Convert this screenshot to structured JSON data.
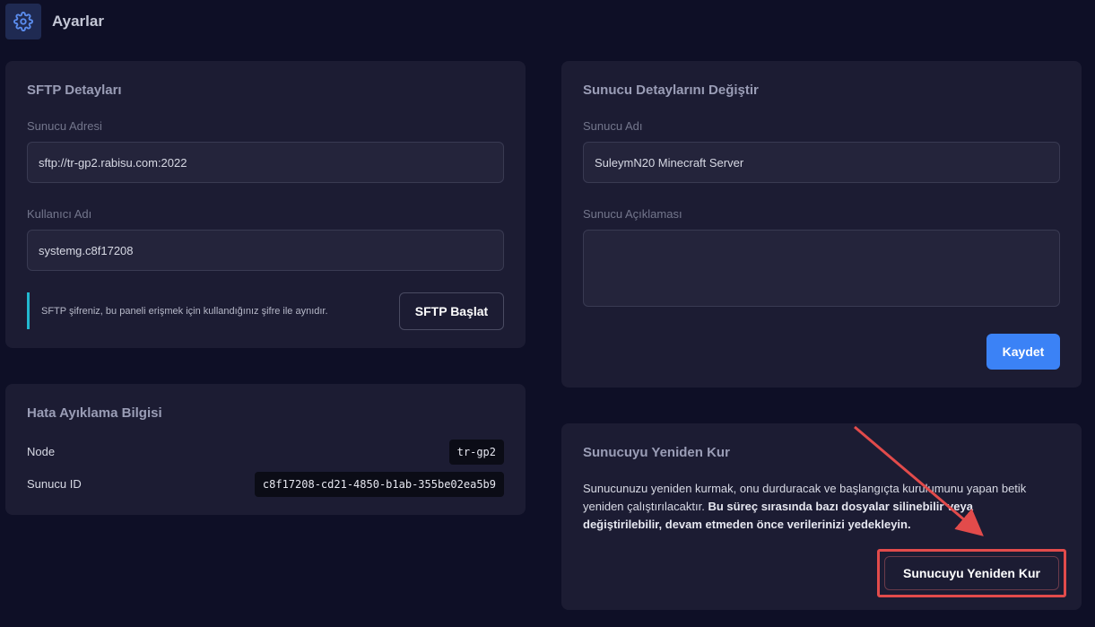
{
  "header": {
    "title": "Ayarlar",
    "icon": "gear-icon"
  },
  "sftp": {
    "title": "SFTP Detayları",
    "address_label": "Sunucu Adresi",
    "address_value": "sftp://tr-gp2.rabisu.com:2022",
    "username_label": "Kullanıcı Adı",
    "username_value": "systemg.c8f17208",
    "note": "SFTP şifreniz, bu paneli erişmek için kullandığınız şifre ile aynıdır.",
    "button_label": "SFTP Başlat"
  },
  "debug": {
    "title": "Hata Ayıklama Bilgisi",
    "node_label": "Node",
    "node_value": "tr-gp2",
    "id_label": "Sunucu ID",
    "id_value": "c8f17208-cd21-4850-b1ab-355be02ea5b9"
  },
  "details": {
    "title": "Sunucu Detaylarını Değiştir",
    "name_label": "Sunucu Adı",
    "name_value": "SuleymN20 Minecraft Server",
    "description_label": "Sunucu Açıklaması",
    "description_value": "",
    "save_label": "Kaydet"
  },
  "reinstall": {
    "title": "Sunucuyu Yeniden Kur",
    "text_plain": "Sunucunuzu yeniden kurmak, onu durduracak ve başlangıçta kurulumunu yapan betik yeniden çalıştırılacaktır. ",
    "text_bold": "Bu süreç sırasında bazı dosyalar silinebilir veya değiştirilebilir, devam etmeden önce verilerinizi yedekleyin.",
    "button_label": "Sunucuyu Yeniden Kur"
  },
  "colors": {
    "background": "#0e0f26",
    "card": "#1c1c33",
    "primary": "#3b82f6",
    "note_accent": "#22b8cf",
    "annotation": "#e24b4b"
  }
}
